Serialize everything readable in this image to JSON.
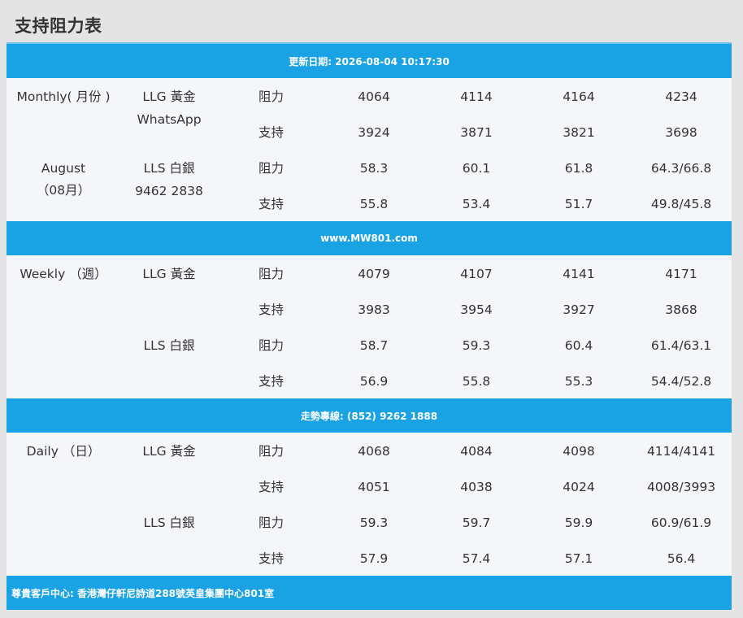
{
  "page_title": "支持阻力表",
  "header_bar": "更新日期: 2026-08-04 10:17:30",
  "mid_bar_1": "www.MW801.com",
  "mid_bar_2": "走勢專線: (852) 9262 1888",
  "footer_bar": "尊貴客戶中心: 香港灣仔軒尼詩道288號英皇集團中心801室",
  "sections": {
    "monthly": {
      "period_line1": "Monthly( 月份 )",
      "period_line2": "August",
      "period_line3": "（08月）",
      "gold_label": "LLG 黃金",
      "gold_sub": "WhatsApp",
      "silver_label": "LLS 白銀",
      "silver_sub": "9462 2838",
      "gold_res": [
        "4064",
        "4114",
        "4164",
        "4234"
      ],
      "gold_sup": [
        "3924",
        "3871",
        "3821",
        "3698"
      ],
      "silver_res": [
        "58.3",
        "60.1",
        "61.8",
        "64.3/66.8"
      ],
      "silver_sup": [
        "55.8",
        "53.4",
        "51.7",
        "49.8/45.8"
      ]
    },
    "weekly": {
      "period_line1": "Weekly （週）",
      "gold_label": "LLG 黃金",
      "silver_label": "LLS 白銀",
      "gold_res": [
        "4079",
        "4107",
        "4141",
        "4171"
      ],
      "gold_sup": [
        "3983",
        "3954",
        "3927",
        "3868"
      ],
      "silver_res": [
        "58.7",
        "59.3",
        "60.4",
        "61.4/63.1"
      ],
      "silver_sup": [
        "56.9",
        "55.8",
        "55.3",
        "54.4/52.8"
      ]
    },
    "daily": {
      "period_line1": "Daily （日）",
      "gold_label": "LLG 黃金",
      "silver_label": "LLS 白銀",
      "gold_res": [
        "4068",
        "4084",
        "4098",
        "4114/4141"
      ],
      "gold_sup": [
        "4051",
        "4038",
        "4024",
        "4008/3993"
      ],
      "silver_res": [
        "59.3",
        "59.7",
        "59.9",
        "60.9/61.9"
      ],
      "silver_sup": [
        "57.9",
        "57.4",
        "57.1",
        "56.4"
      ]
    }
  },
  "labels": {
    "resistance": "阻力",
    "support": "支持"
  }
}
